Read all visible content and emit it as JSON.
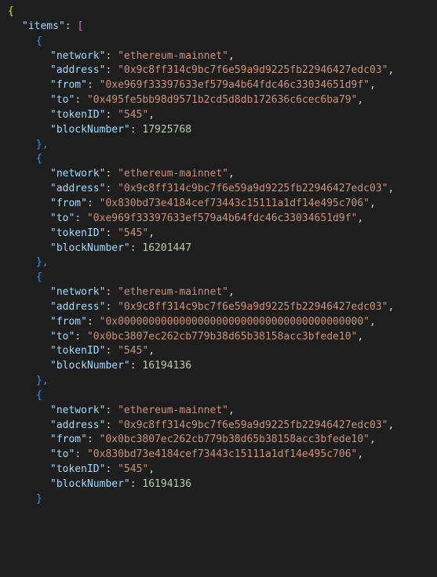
{
  "json": {
    "open_brace": "{",
    "items_key": "\"items\"",
    "items_open": "[",
    "entries": [
      {
        "network_key": "\"network\"",
        "network_val": "\"ethereum-mainnet\"",
        "address_key": "\"address\"",
        "address_val": "\"0x9c8ff314c9bc7f6e59a9d9225fb22946427edc03\"",
        "from_key": "\"from\"",
        "from_val": "\"0xe969f33397633ef579a4b64fdc46c33034651d9f\"",
        "to_key": "\"to\"",
        "to_val": "\"0x495fe5bb98d9571b2cd5d8db172636c6cec6ba79\"",
        "tokenid_key": "\"tokenID\"",
        "tokenid_val": "\"545\"",
        "blocknum_key": "\"blockNumber\"",
        "blocknum_val": "17925768"
      },
      {
        "network_key": "\"network\"",
        "network_val": "\"ethereum-mainnet\"",
        "address_key": "\"address\"",
        "address_val": "\"0x9c8ff314c9bc7f6e59a9d9225fb22946427edc03\"",
        "from_key": "\"from\"",
        "from_val": "\"0x830bd73e4184cef73443c15111a1df14e495c706\"",
        "to_key": "\"to\"",
        "to_val": "\"0xe969f33397633ef579a4b64fdc46c33034651d9f\"",
        "tokenid_key": "\"tokenID\"",
        "tokenid_val": "\"545\"",
        "blocknum_key": "\"blockNumber\"",
        "blocknum_val": "16201447"
      },
      {
        "network_key": "\"network\"",
        "network_val": "\"ethereum-mainnet\"",
        "address_key": "\"address\"",
        "address_val": "\"0x9c8ff314c9bc7f6e59a9d9225fb22946427edc03\"",
        "from_key": "\"from\"",
        "from_val": "\"0x0000000000000000000000000000000000000000\"",
        "to_key": "\"to\"",
        "to_val": "\"0x0bc3807ec262cb779b38d65b38158acc3bfede10\"",
        "tokenid_key": "\"tokenID\"",
        "tokenid_val": "\"545\"",
        "blocknum_key": "\"blockNumber\"",
        "blocknum_val": "16194136"
      },
      {
        "network_key": "\"network\"",
        "network_val": "\"ethereum-mainnet\"",
        "address_key": "\"address\"",
        "address_val": "\"0x9c8ff314c9bc7f6e59a9d9225fb22946427edc03\"",
        "from_key": "\"from\"",
        "from_val": "\"0x0bc3807ec262cb779b38d65b38158acc3bfede10\"",
        "to_key": "\"to\"",
        "to_val": "\"0x830bd73e4184cef73443c15111a1df14e495c706\"",
        "tokenid_key": "\"tokenID\"",
        "tokenid_val": "\"545\"",
        "blocknum_key": "\"blockNumber\"",
        "blocknum_val": "16194136"
      }
    ],
    "obj_open": "{",
    "obj_close_comma": "},",
    "obj_close": "}"
  }
}
